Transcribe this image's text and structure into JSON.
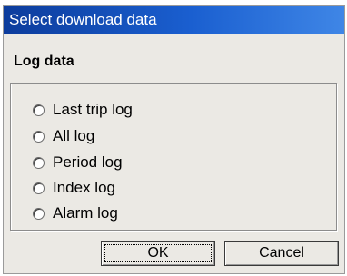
{
  "window": {
    "title": "Select download data"
  },
  "section": {
    "title": "Log data"
  },
  "options": [
    {
      "label": "Last trip log",
      "selected": false
    },
    {
      "label": "All log",
      "selected": false
    },
    {
      "label": "Period log",
      "selected": false
    },
    {
      "label": "Index log",
      "selected": false
    },
    {
      "label": "Alarm log",
      "selected": false
    }
  ],
  "buttons": {
    "ok_label": "OK",
    "cancel_label": "Cancel"
  },
  "colors": {
    "titlebar_start": "#0c3c9c",
    "titlebar_end": "#3f86e6",
    "dialog_background": "#ebe9e4"
  }
}
